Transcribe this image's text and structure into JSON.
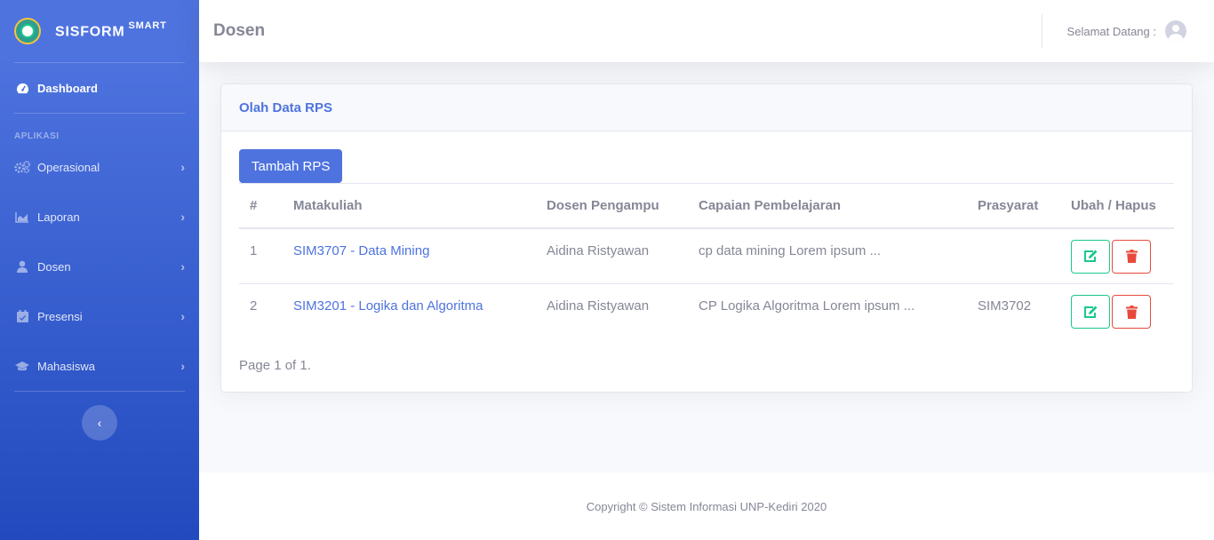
{
  "brand": {
    "name": "SISFORM",
    "sup": "SMART"
  },
  "sidebar": {
    "dashboard": "Dashboard",
    "heading": "APLIKASI",
    "items": [
      {
        "label": "Operasional",
        "icon": "cogs-icon"
      },
      {
        "label": "Laporan",
        "icon": "chart-area-icon"
      },
      {
        "label": "Dosen",
        "icon": "user-icon"
      },
      {
        "label": "Presensi",
        "icon": "calendar-check-icon"
      },
      {
        "label": "Mahasiswa",
        "icon": "graduation-cap-icon"
      }
    ],
    "toggle": "‹"
  },
  "topbar": {
    "title": "Dosen",
    "welcome": "Selamat Datang :"
  },
  "card": {
    "title": "Olah Data RPS",
    "add_button": "Tambah RPS",
    "columns": [
      "#",
      "Matakuliah",
      "Dosen Pengampu",
      "Capaian Pembelajaran",
      "Prasyarat",
      "Ubah / Hapus"
    ],
    "rows": [
      {
        "no": "1",
        "matakuliah": "SIM3707 - Data Mining",
        "dosen": "Aidina Ristyawan",
        "capaian": "cp data mining Lorem ipsum ...",
        "prasyarat": ""
      },
      {
        "no": "2",
        "matakuliah": "SIM3201 - Logika dan Algoritma",
        "dosen": "Aidina Ristyawan",
        "capaian": "CP Logika Algoritma Lorem ipsum ...",
        "prasyarat": "SIM3702"
      }
    ],
    "pager": "Page 1 of 1."
  },
  "footer": {
    "text": "Copyright © Sistem Informasi UNP-Kediri 2020"
  },
  "colors": {
    "primary": "#4e73df",
    "success": "#1cc88a",
    "danger": "#e74a3b"
  }
}
